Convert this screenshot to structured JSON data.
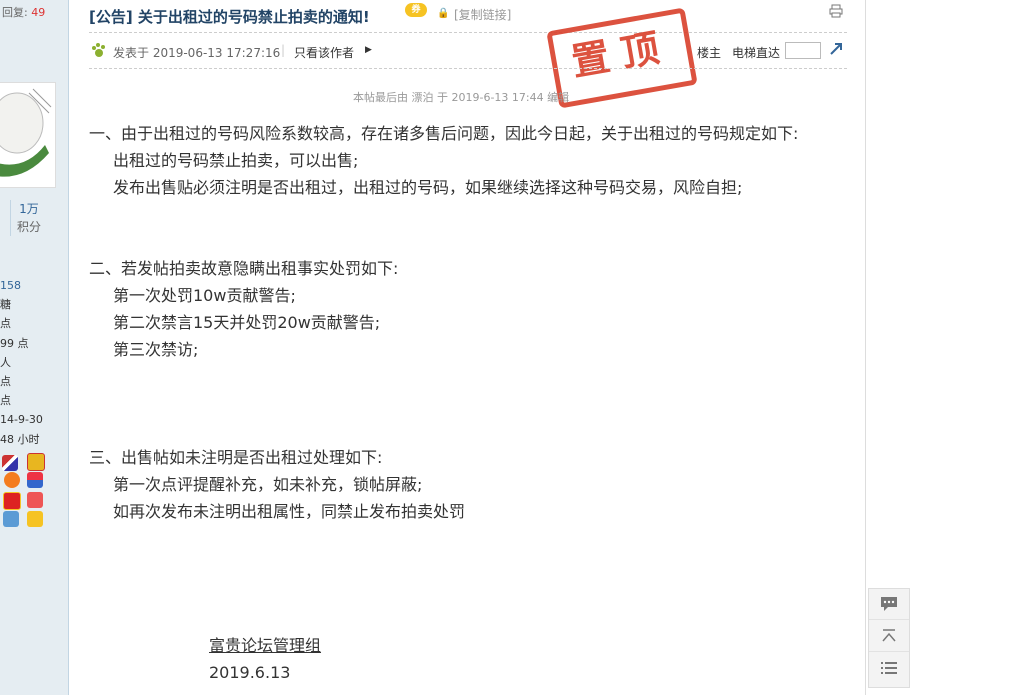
{
  "sidebar": {
    "reply_label": "回复:",
    "reply_count": "49",
    "score_value": "1万",
    "score_label": "积分",
    "stats": [
      "158",
      "糖",
      "点",
      "99 点",
      "人",
      "点",
      " 点",
      "14-9-30",
      "48 小时"
    ]
  },
  "thread": {
    "title": "[公告] 关于出租过的号码禁止拍卖的通知!",
    "coupon_badge": "券",
    "copy_link": "[复制链接]",
    "stamp": "置顶"
  },
  "post": {
    "posted_at": "发表于 2019-06-13 17:27:16",
    "separator": "|",
    "author_only": "只看该作者",
    "floor_label": "楼主",
    "elevator_label": "电梯直达",
    "edit_note": "本帖最后由 漂泊 于 2019-6-13 17:44 编辑",
    "paragraphs": [
      "一、由于出租过的号码风险系数较高，存在诸多售后问题，因此今日起，关于出租过的号码规定如下:",
      "出租过的号码禁止拍卖，可以出售;",
      "发布出售贴必须注明是否出租过，出租过的号码，如果继续选择这种号码交易，风险自担;",
      "二、若发帖拍卖故意隐瞒出租事实处罚如下:",
      "第一次处罚10w贡献警告;",
      "第二次禁言15天并处罚20w贡献警告;",
      "第三次禁访;",
      "三、出售帖如未注明是否出租过处理如下:",
      "第一次点评提醒补充，如未补充，锁帖屏蔽;",
      "如再次发布未注明出租属性，同禁止发布拍卖处罚"
    ],
    "signature_org": "富贵论坛管理组",
    "signature_date": "2019.6.13"
  },
  "colors": {
    "stamp": "#d9402b",
    "title": "#224466",
    "sidebar_bg": "#e5edf2"
  }
}
